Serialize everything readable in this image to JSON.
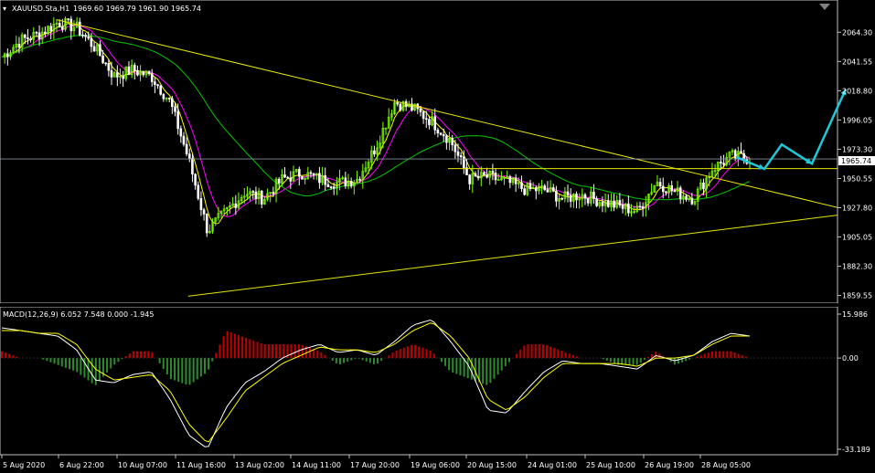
{
  "header": {
    "symbol": "XAUUSD.Sta,H1",
    "ohlc": "1969.60 1969.79 1961.90 1965.74"
  },
  "macd_header": "MACD(12,26,9) 6.052 7.548 0.000 -1.945",
  "price_axis": {
    "ticks": [
      "2064.30",
      "2041.55",
      "2018.80",
      "1996.05",
      "1973.30",
      "1950.55",
      "1927.80",
      "1905.05",
      "1882.30",
      "1859.55"
    ],
    "current_price": "1965.74"
  },
  "macd_axis": {
    "ticks": [
      "15.986",
      "0.00",
      "-33.189"
    ]
  },
  "time_axis": {
    "ticks": [
      "5 Aug 2020",
      "6 Aug 22:00",
      "10 Aug 07:00",
      "11 Aug 16:00",
      "13 Aug 02:00",
      "14 Aug 11:00",
      "17 Aug 20:00",
      "19 Aug 06:00",
      "20 Aug 15:00",
      "24 Aug 01:00",
      "25 Aug 10:00",
      "26 Aug 19:00",
      "28 Aug 05:00"
    ]
  },
  "colors": {
    "background": "#000000",
    "candle_up": "#7fff00",
    "candle_down": "#ffffff",
    "ma_fast": "#ffff00",
    "ma_mid": "#ff00ff",
    "ma_slow": "#00c800",
    "trendline": "#e6e600",
    "forecast_arrow": "#20c8d8",
    "macd_hist_pos": "#c00000",
    "macd_hist_neg": "#2e8b2e",
    "macd_line": "#ffffff",
    "signal_line": "#ffff00",
    "axis": "#c0c0c0"
  },
  "chart_data": [
    {
      "type": "candlestick",
      "title": "XAUUSD.Sta,H1",
      "ylim": [
        1855,
        2078
      ],
      "x": [
        "5 Aug 2020",
        "6 Aug 22:00",
        "10 Aug 07:00",
        "11 Aug 16:00",
        "13 Aug 02:00",
        "14 Aug 11:00",
        "17 Aug 20:00",
        "19 Aug 06:00",
        "20 Aug 15:00",
        "24 Aug 01:00",
        "25 Aug 10:00",
        "26 Aug 19:00",
        "28 Aug 05:00"
      ],
      "close_path": [
        2045,
        2058,
        2063,
        2072,
        2068,
        2052,
        2030,
        2035,
        2030,
        2010,
        1965,
        1910,
        1925,
        1940,
        1935,
        1950,
        1955,
        1950,
        1947,
        1950,
        1975,
        2010,
        2005,
        1995,
        1980,
        1950,
        1952,
        1948,
        1942,
        1942,
        1935,
        1938,
        1933,
        1929,
        1925,
        1948,
        1940,
        1935,
        1958,
        1968,
        1966
      ],
      "price_levels": {
        "current": 1965.74,
        "horizontal_resistance": 1958.2
      },
      "trendlines": [
        {
          "name": "upper",
          "from": [
            0.065,
            2074
          ],
          "to": [
            1.0,
            1928
          ]
        },
        {
          "name": "lower",
          "from": [
            0.215,
            1859
          ],
          "to": [
            1.0,
            1922
          ]
        }
      ],
      "forecast_zigzag": [
        1967,
        1958,
        1977,
        1962,
        2020
      ]
    },
    {
      "type": "line",
      "title": "MACD(12,26,9)",
      "ylim": [
        -33.189,
        15.986
      ],
      "series": [
        {
          "name": "MACD",
          "values": [
            11,
            10,
            9,
            8,
            3,
            -8,
            -9,
            -6,
            -5,
            -15,
            -28,
            -33,
            -18,
            -9,
            -5,
            0,
            3,
            5,
            2,
            3,
            1,
            6,
            12,
            14,
            6,
            -3,
            -19,
            -20,
            -12,
            -5,
            -1,
            -2,
            -2,
            -3,
            -4,
            1,
            -1,
            1,
            6,
            9,
            8
          ]
        },
        {
          "name": "Signal",
          "values": [
            10,
            10,
            9,
            9,
            5,
            -4,
            -8,
            -7,
            -6,
            -12,
            -24,
            -31,
            -22,
            -12,
            -7,
            -2,
            1,
            4,
            3,
            3,
            2,
            5,
            10,
            13,
            8,
            0,
            -15,
            -19,
            -14,
            -7,
            -2,
            -2,
            -2,
            -2,
            -3,
            0,
            0,
            1,
            5,
            8,
            8
          ]
        },
        {
          "name": "Histogram",
          "values": [
            1,
            0,
            0,
            -1,
            -2,
            -4,
            -1,
            1,
            1,
            -3,
            -4,
            -2,
            4,
            3,
            2,
            2,
            2,
            1,
            -1,
            0,
            -1,
            1,
            2,
            1,
            -2,
            -3,
            -4,
            -1,
            2,
            2,
            1,
            0,
            0,
            -1,
            -1,
            1,
            -1,
            0,
            1,
            1,
            0
          ]
        }
      ]
    }
  ]
}
